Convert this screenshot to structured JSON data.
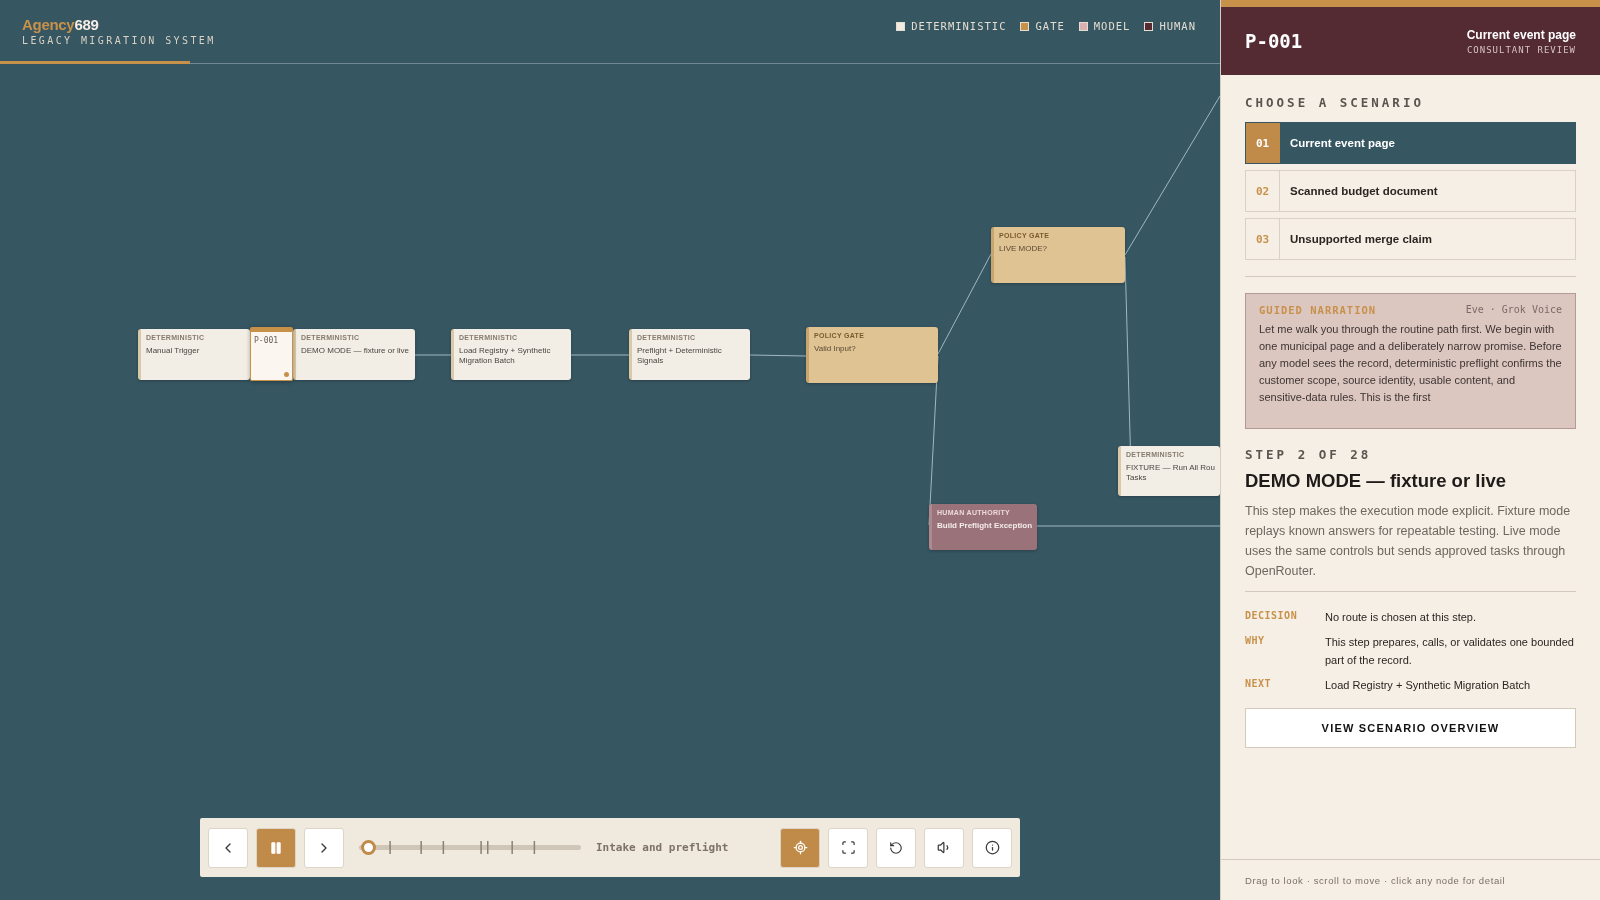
{
  "brand": {
    "name_part1": "Agency",
    "name_part2": "689",
    "subtitle": "LEGACY MIGRATION SYSTEM"
  },
  "legend": [
    {
      "label": "DETERMINISTIC",
      "color": "#f1ebe0"
    },
    {
      "label": "GATE",
      "color": "#c8914a"
    },
    {
      "label": "MODEL",
      "color": "#d8b0b0"
    },
    {
      "label": "HUMAN",
      "color": "#5a2a33"
    }
  ],
  "graph": {
    "nodes": [
      {
        "kind": "deterministic",
        "tag": "DETERMINISTIC",
        "lines": [
          "Manual Trigger"
        ]
      },
      {
        "kind": "deterministic",
        "tag": "DETERMINISTIC",
        "lines": [
          "DEMO MODE — fixture or live"
        ]
      },
      {
        "kind": "deterministic",
        "tag": "DETERMINISTIC",
        "lines": [
          "Load Registry + Synthetic",
          "Migration Batch"
        ]
      },
      {
        "kind": "deterministic",
        "tag": "DETERMINISTIC",
        "lines": [
          "Preflight + Deterministic",
          "Signals"
        ]
      },
      {
        "kind": "gate",
        "tag": "POLICY GATE",
        "lines": [
          "Valid Input?"
        ]
      },
      {
        "kind": "gate",
        "tag": "POLICY GATE",
        "lines": [
          "LIVE MODE?"
        ]
      },
      {
        "kind": "human",
        "tag": "HUMAN AUTHORITY",
        "lines": [
          "Build Preflight Exception"
        ]
      },
      {
        "kind": "deterministic",
        "tag": "DETERMINISTIC",
        "lines": [
          "FIXTURE — Run All Rou",
          "Tasks"
        ]
      }
    ],
    "marker": {
      "code": "P-001"
    }
  },
  "controls": {
    "playing": true,
    "progress": {
      "level": 0.04
    },
    "stage": "Intake and preflight"
  },
  "panel": {
    "header": {
      "code": "P-001",
      "title": "Current event page",
      "subtitle": "CONSULTANT REVIEW"
    },
    "scenarios_heading": "CHOOSE A SCENARIO",
    "scenarios": [
      {
        "number": "01",
        "label": "Current event page",
        "selected": true
      },
      {
        "number": "02",
        "label": "Scanned budget document",
        "selected": false
      },
      {
        "number": "03",
        "label": "Unsupported merge claim",
        "selected": false
      }
    ],
    "narration": {
      "heading": "GUIDED NARRATION",
      "voice": "Eve · Grok Voice",
      "text": "Let me walk you through the routine path first. We begin with one municipal page and a deliberately narrow promise. Before any model sees the record, deterministic preflight confirms the customer scope, source identity, usable content, and sensitive-data rules. This is the first"
    },
    "step": {
      "counter": "STEP 2 OF 28",
      "title": "DEMO MODE — fixture or live",
      "description": "This step makes the execution mode explicit. Fixture mode replays known answers for repeatable testing. Live mode uses the same controls but sends approved tasks through OpenRouter."
    },
    "facts": [
      {
        "label": "DECISION",
        "value": "No route is chosen at this step."
      },
      {
        "label": "WHY",
        "value": "This step prepares, calls, or validates one bounded part of the record."
      },
      {
        "label": "NEXT",
        "value": "Load Registry + Synthetic Migration Batch"
      }
    ],
    "overview_button": "VIEW SCENARIO OVERVIEW",
    "footer": "Drag to look · scroll to move · click any node for detail"
  }
}
